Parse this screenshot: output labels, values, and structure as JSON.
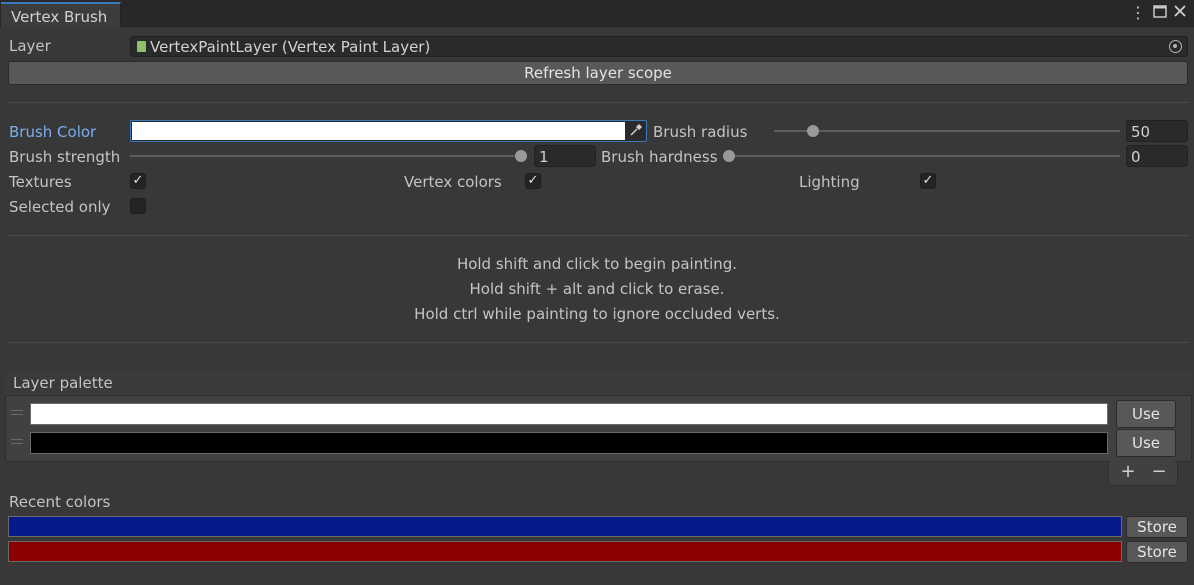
{
  "window": {
    "tab_title": "Vertex Brush",
    "menu_icon": "kebab-menu-icon",
    "maximize_icon": "maximize-icon",
    "close_icon": "close-icon"
  },
  "layer": {
    "label": "Layer",
    "value": "VertexPaintLayer (Vertex Paint Layer)",
    "refresh_label": "Refresh layer scope"
  },
  "brush": {
    "color_label": "Brush Color",
    "color_value": "#FFFFFF",
    "eyedropper_icon": "eyedropper-icon",
    "radius_label": "Brush radius",
    "radius_value": "50",
    "radius_fraction": 0.05,
    "strength_label": "Brush strength",
    "strength_value": "1",
    "strength_fraction": 1.0,
    "hardness_label": "Brush hardness",
    "hardness_value": "0",
    "hardness_fraction": 0.0
  },
  "toggles": {
    "textures_label": "Textures",
    "textures_checked": true,
    "vertex_colors_label": "Vertex colors",
    "vertex_colors_checked": true,
    "lighting_label": "Lighting",
    "lighting_checked": true,
    "selected_only_label": "Selected only",
    "selected_only_checked": false
  },
  "instructions": {
    "line1": "Hold shift and click to begin painting.",
    "line2": "Hold shift + alt and click to erase.",
    "line3": "Hold ctrl while painting to ignore occluded verts."
  },
  "palette": {
    "title": "Layer palette",
    "items": [
      {
        "color": "#FFFFFF",
        "use_label": "Use"
      },
      {
        "color": "#000000",
        "use_label": "Use"
      }
    ],
    "add_label": "+",
    "remove_label": "−"
  },
  "recent": {
    "title": "Recent colors",
    "items": [
      {
        "color": "#061A8C",
        "store_label": "Store"
      },
      {
        "color": "#8C0000",
        "store_label": "Store"
      }
    ]
  },
  "colors": {
    "accent": "#3A79BB",
    "label_highlight": "#7BAEF0"
  }
}
